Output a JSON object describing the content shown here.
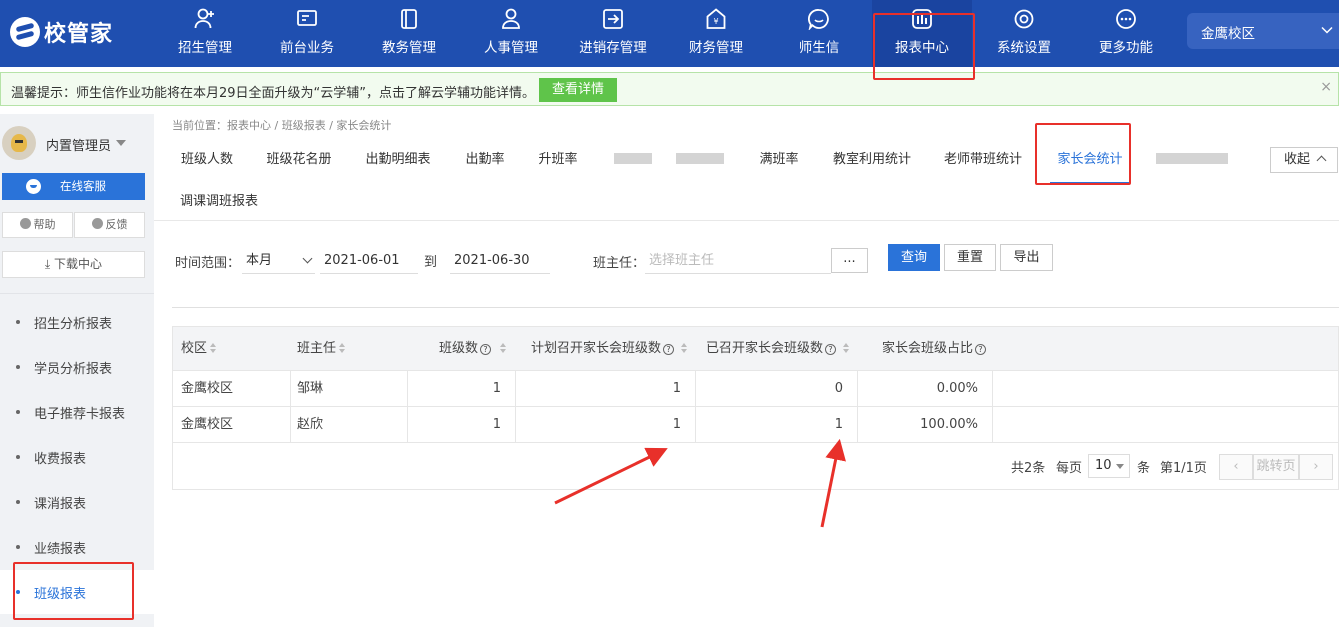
{
  "app": {
    "logo_text": "校管家"
  },
  "nav": {
    "items": [
      {
        "label": "招生管理",
        "icon": "person-add-icon"
      },
      {
        "label": "前台业务",
        "icon": "screen-icon"
      },
      {
        "label": "教务管理",
        "icon": "book-icon"
      },
      {
        "label": "人事管理",
        "icon": "person-icon"
      },
      {
        "label": "进销存管理",
        "icon": "import-icon"
      },
      {
        "label": "财务管理",
        "icon": "yen-shield-icon"
      },
      {
        "label": "师生信",
        "icon": "chat-icon"
      },
      {
        "label": "报表中心",
        "icon": "report-icon",
        "active": true
      },
      {
        "label": "系统设置",
        "icon": "gear-icon"
      },
      {
        "label": "更多功能",
        "icon": "more-icon"
      }
    ],
    "campus": "金鹰校区"
  },
  "notice": {
    "text": "温馨提示：师生信作业功能将在本月29日全面升级为“云学辅”，点击了解云学辅功能详情。",
    "button": "查看详情",
    "close": "×"
  },
  "sidebar": {
    "user": "内置管理员",
    "service_button": "在线客服",
    "help": "帮助",
    "feedback": "反馈",
    "download": "下载中心",
    "items": [
      {
        "label": "招生分析报表"
      },
      {
        "label": "学员分析报表"
      },
      {
        "label": "电子推荐卡报表"
      },
      {
        "label": "收费报表"
      },
      {
        "label": "课消报表"
      },
      {
        "label": "业绩报表"
      },
      {
        "label": "班级报表",
        "active": true
      }
    ]
  },
  "breadcrumb": "当前位置：报表中心 / 班级报表 / 家长会统计",
  "tabs": [
    {
      "label": "班级人数"
    },
    {
      "label": "班级花名册"
    },
    {
      "label": "出勤明细表"
    },
    {
      "label": "出勤率"
    },
    {
      "label": "升班率"
    },
    {
      "label": "满班率"
    },
    {
      "label": "教室利用统计"
    },
    {
      "label": "老师带班统计"
    },
    {
      "label": "家长会统计",
      "active": true
    },
    {
      "label": "调课调班报表"
    }
  ],
  "collapse_button": "收起",
  "filters": {
    "time_range_label": "时间范围：",
    "period": "本月",
    "start_date": "2021-06-01",
    "to": "到",
    "end_date": "2021-06-30",
    "head_teacher_label": "班主任：",
    "head_teacher_placeholder": "选择班主任",
    "ellipsis_button": "...",
    "query": "查询",
    "reset": "重置",
    "export": "导出"
  },
  "table": {
    "columns": [
      "校区",
      "班主任",
      "班级数",
      "计划召开家长会班级数",
      "已召开家长会班级数",
      "家长会班级占比"
    ],
    "rows": [
      [
        "金鹰校区",
        "邹琳",
        "1",
        "1",
        "0",
        "0.00%"
      ],
      [
        "金鹰校区",
        "赵欣",
        "1",
        "1",
        "1",
        "100.00%"
      ]
    ]
  },
  "pagination": {
    "total": "共2条",
    "per_page_label": "每页",
    "page_size": "10",
    "unit": "条",
    "page_info": "第1/1页",
    "prev": "‹",
    "jump": "跳转页",
    "next": "›"
  },
  "colors": {
    "nav_bg": "#1f4fb0",
    "accent": "#2a73d9",
    "annotation": "#e8302a",
    "notice_button": "#5fc44a"
  }
}
